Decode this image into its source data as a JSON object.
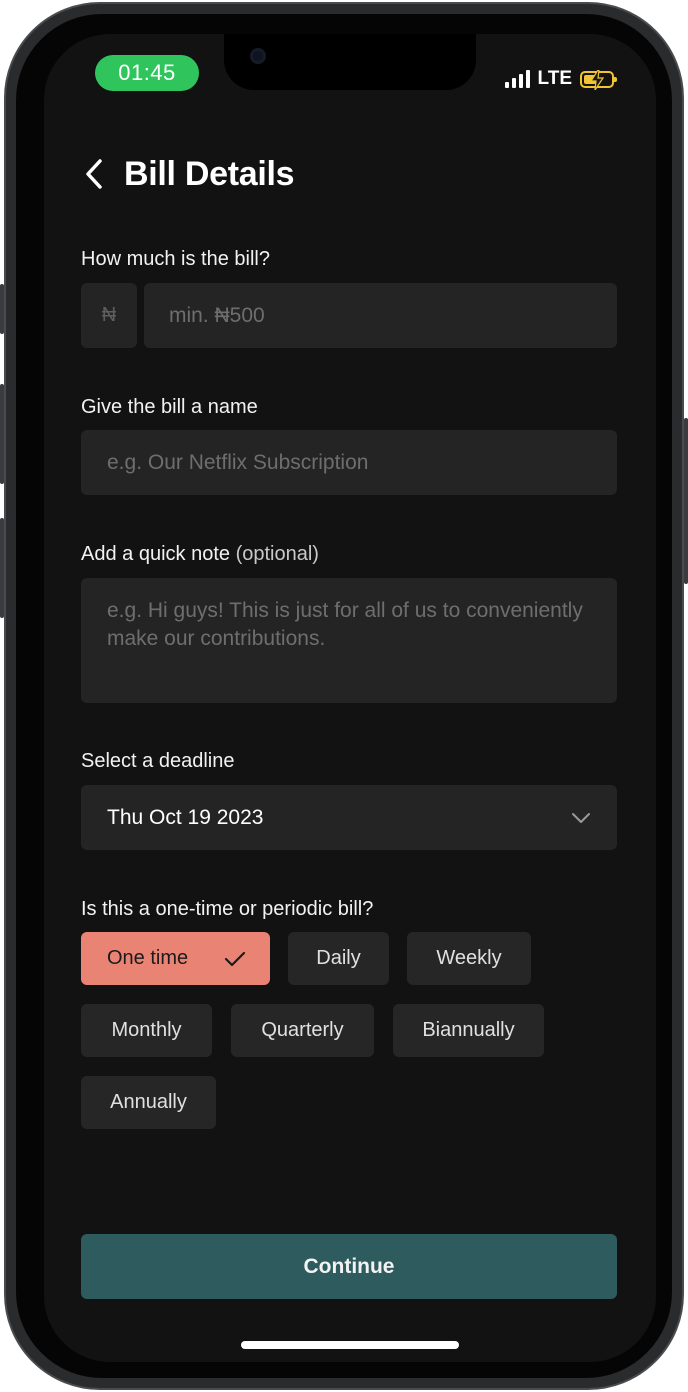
{
  "status_bar": {
    "time": "01:45",
    "network": "LTE",
    "colors": {
      "time_pill": "#30c55c",
      "battery": "#f4c430"
    }
  },
  "header": {
    "title": "Bill Details"
  },
  "amount": {
    "label": "How much is the bill?",
    "currency_symbol": "₦",
    "placeholder": "min. ₦500"
  },
  "name": {
    "label": "Give the bill a name",
    "placeholder": "e.g. Our Netflix Subscription"
  },
  "note": {
    "label": "Add a quick note",
    "label_suffix": "(optional)",
    "placeholder": "e.g. Hi guys! This is just for all of us to conveniently make our contributions."
  },
  "deadline": {
    "label": "Select a deadline",
    "value": "Thu Oct 19 2023"
  },
  "frequency": {
    "label": "Is this a one-time or periodic bill?",
    "options": [
      "One time",
      "Daily",
      "Weekly",
      "Monthly",
      "Quarterly",
      "Biannually",
      "Annually"
    ],
    "selected": "One time",
    "colors": {
      "selected": "#e98474",
      "default": "#262626"
    }
  },
  "actions": {
    "continue_label": "Continue",
    "color": "#2e5b5e"
  }
}
